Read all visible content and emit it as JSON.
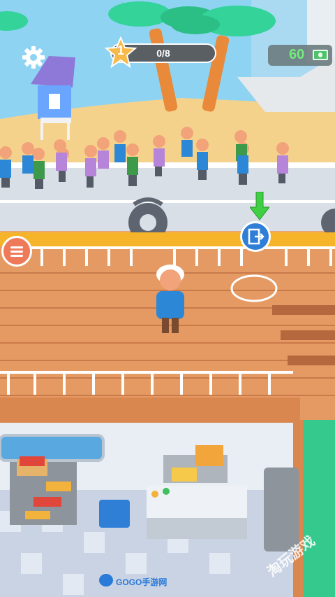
{
  "hud": {
    "level": "1",
    "progress_text": "0/8",
    "progress_fraction": 0,
    "money": "60",
    "icons": {
      "settings": "gear-icon",
      "level": "star-icon",
      "money": "cash-icon",
      "menu": "menu-icon",
      "exit": "exit-door-icon",
      "target": "down-arrow-icon"
    }
  },
  "watermark": {
    "bottom": "GOGO手游网",
    "corner": "淘玩游戏"
  },
  "colors": {
    "sky": "#8fd3f3",
    "sand": "#f5d28c",
    "road": "#d9dfe6",
    "deck": "#e49a62",
    "railing": "#ffffff",
    "galley_floor": "#c9d3e3",
    "accent_blue": "#2f7fd6",
    "accent_orange": "#ef7a5a",
    "cash_green": "#6ef06e"
  }
}
